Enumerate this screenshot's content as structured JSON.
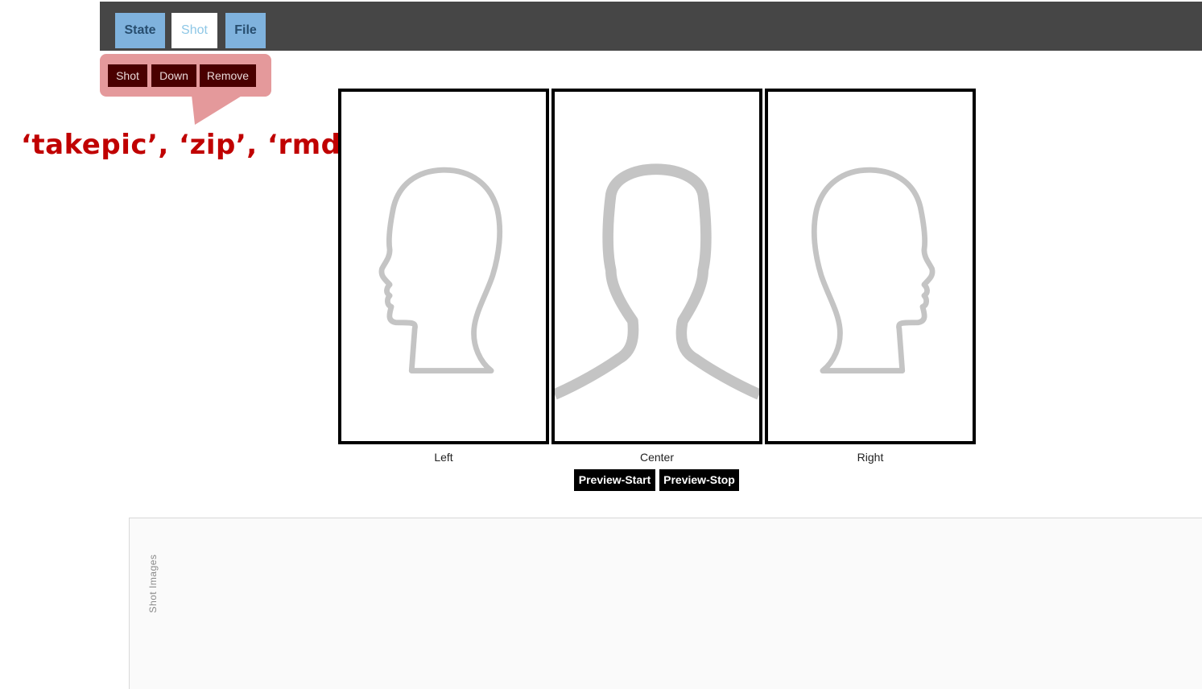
{
  "tabs": [
    {
      "label": "State"
    },
    {
      "label": "Shot"
    },
    {
      "label": "File"
    }
  ],
  "submenu": [
    {
      "label": "Shot"
    },
    {
      "label": "Down"
    },
    {
      "label": "Remove"
    }
  ],
  "annotation": "‘takepic’, ‘zip’, ‘rmdir",
  "frames": [
    {
      "label": "Left",
      "icon": "head-profile-left-icon"
    },
    {
      "label": "Center",
      "icon": "head-front-icon"
    },
    {
      "label": "Right",
      "icon": "head-profile-right-icon"
    }
  ],
  "preview": {
    "start_label": "Preview-Start",
    "stop_label": "Preview-Stop"
  },
  "shot_images": {
    "label": "Shot Images"
  },
  "colors": {
    "topbar": "#464646",
    "tab_active_bg": "#7fb2dd",
    "callout": "#e4999b",
    "submenu_button": "#4a0000",
    "annotation": "#c00000",
    "silhouette": "#c4c4c4"
  }
}
